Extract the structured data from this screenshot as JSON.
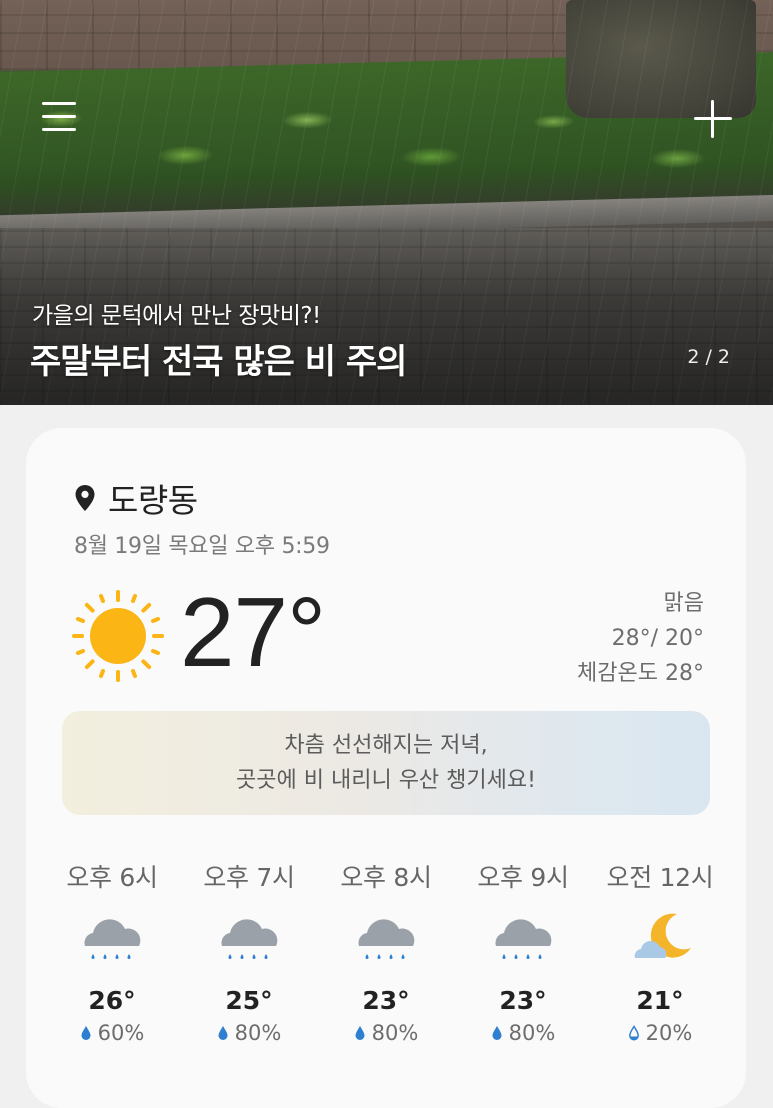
{
  "hero": {
    "subtitle": "가을의 문턱에서 만난 장맛비?!",
    "title": "주말부터 전국 많은 비 주의",
    "pager": "2 / 2",
    "menu_icon": "hamburger-menu-icon",
    "add_icon": "plus-icon"
  },
  "weather": {
    "location": "도량동",
    "location_icon": "location-pin-icon",
    "datetime": "8월 19일 목요일 오후 5:59",
    "current_icon": "sun-icon",
    "temperature": "27°",
    "condition": "맑음",
    "high_low": "28°/ 20°",
    "feels_like": "체감온도 28°",
    "message_line1": "차츰 선선해지는 저녁,",
    "message_line2": "곳곳에 비 내리니 우산 챙기세요!",
    "colors": {
      "sun": "#fbb514",
      "cloud": "#9aa1a8",
      "rain_drop": "#2f7fd0",
      "moon": "#f5b52a"
    }
  },
  "hourly": [
    {
      "time": "오후 6시",
      "icon": "rain-cloud-icon",
      "temp": "26°",
      "precip": "60%"
    },
    {
      "time": "오후 7시",
      "icon": "rain-cloud-icon",
      "temp": "25°",
      "precip": "80%"
    },
    {
      "time": "오후 8시",
      "icon": "rain-cloud-icon",
      "temp": "23°",
      "precip": "80%"
    },
    {
      "time": "오후 9시",
      "icon": "rain-cloud-icon",
      "temp": "23°",
      "precip": "80%"
    },
    {
      "time": "오전 12시",
      "icon": "moon-cloud-icon",
      "temp": "21°",
      "precip": "20%"
    }
  ]
}
